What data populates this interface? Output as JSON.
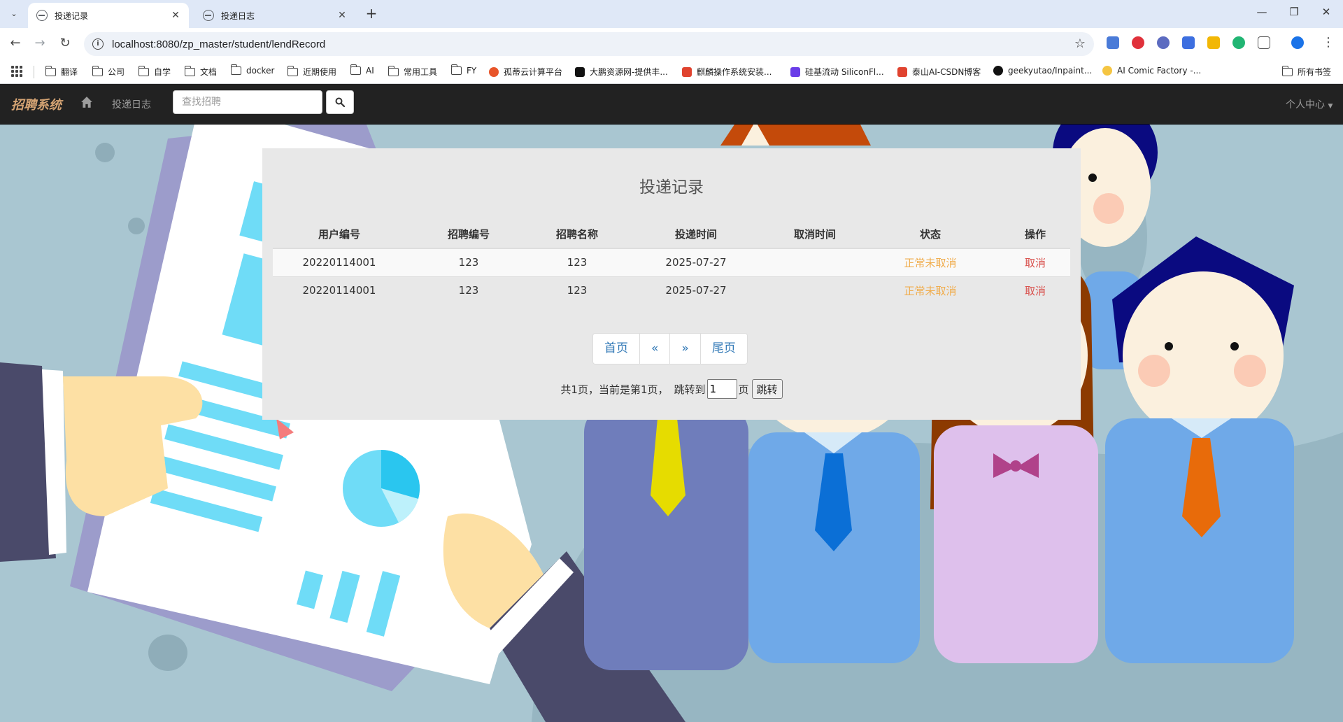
{
  "browser": {
    "tabs": [
      {
        "title": "投递记录",
        "active": true
      },
      {
        "title": "投递日志",
        "active": false
      }
    ],
    "url": "localhost:8080/zp_master/student/lendRecord",
    "bookmarks": [
      {
        "label": "翻译",
        "icon": "folder"
      },
      {
        "label": "公司",
        "icon": "folder"
      },
      {
        "label": "自学",
        "icon": "folder"
      },
      {
        "label": "文档",
        "icon": "folder"
      },
      {
        "label": "docker",
        "icon": "folder"
      },
      {
        "label": "近期使用",
        "icon": "folder"
      },
      {
        "label": "AI",
        "icon": "folder"
      },
      {
        "label": "常用工具",
        "icon": "folder"
      },
      {
        "label": "FY",
        "icon": "folder"
      },
      {
        "label": "孤蒂云计算平台",
        "icon": "site"
      },
      {
        "label": "大鹏资源网-提供丰...",
        "icon": "site"
      },
      {
        "label": "麒麟操作系统安装...",
        "icon": "site"
      },
      {
        "label": "硅基流动 SiliconFl...",
        "icon": "site"
      },
      {
        "label": "泰山AI-CSDN博客",
        "icon": "site"
      },
      {
        "label": "geekyutao/Inpaint...",
        "icon": "github"
      },
      {
        "label": "AI Comic Factory -...",
        "icon": "site"
      }
    ],
    "all_bookmarks_label": "所有书签"
  },
  "navbar": {
    "brand": "招聘系统",
    "link": "投递日志",
    "search_placeholder": "查找招聘",
    "user_menu": "个人中心"
  },
  "panel": {
    "title": "投递记录",
    "columns": [
      "用户编号",
      "招聘编号",
      "招聘名称",
      "投递时间",
      "取消时间",
      "状态",
      "操作"
    ],
    "rows": [
      {
        "user_id": "20220114001",
        "job_id": "123",
        "job_name": "123",
        "apply_time": "2025-07-27",
        "cancel_time": "",
        "status": "正常未取消",
        "action": "取消"
      },
      {
        "user_id": "20220114001",
        "job_id": "123",
        "job_name": "123",
        "apply_time": "2025-07-27",
        "cancel_time": "",
        "status": "正常未取消",
        "action": "取消"
      }
    ],
    "pagination": {
      "first": "首页",
      "prev": "«",
      "next": "»",
      "last": "尾页"
    },
    "page_info": {
      "summary": "共1页，当前是第1页，",
      "jump_to": "跳转到",
      "page_value": "1",
      "page_unit": "页",
      "jump_button": "跳转"
    }
  },
  "colors": {
    "navbar_bg": "#222222",
    "brand": "#d4a373",
    "status": "#f0ad4e",
    "cancel": "#d9534f",
    "link": "#337ab7",
    "background": "#a9c6d1"
  }
}
